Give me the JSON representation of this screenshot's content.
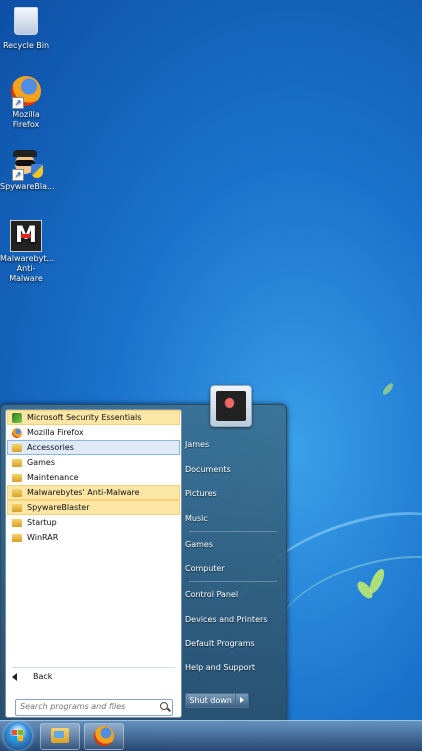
{
  "desktop": {
    "icons": [
      {
        "label": "Recycle Bin",
        "icon": "recycle-bin-icon"
      },
      {
        "label": "Mozilla Firefox",
        "icon": "firefox-icon"
      },
      {
        "label": "SpywareBla...",
        "icon": "spywareblaster-icon"
      },
      {
        "label": "Malwarebyt... Anti-Malware",
        "icon": "malwarebytes-icon"
      }
    ]
  },
  "start_menu": {
    "programs": [
      {
        "label": "Microsoft Security Essentials",
        "icon": "security-essentials-icon",
        "state": "highlighted"
      },
      {
        "label": "Mozilla Firefox",
        "icon": "firefox-icon",
        "state": "normal"
      },
      {
        "label": "Accessories",
        "icon": "folder-icon",
        "state": "selected"
      },
      {
        "label": "Games",
        "icon": "folder-icon",
        "state": "normal"
      },
      {
        "label": "Maintenance",
        "icon": "folder-icon",
        "state": "normal"
      },
      {
        "label": "Malwarebytes' Anti-Malware",
        "icon": "folder-icon",
        "state": "highlighted"
      },
      {
        "label": "SpywareBlaster",
        "icon": "folder-icon",
        "state": "highlighted"
      },
      {
        "label": "Startup",
        "icon": "folder-icon",
        "state": "normal"
      },
      {
        "label": "WinRAR",
        "icon": "folder-icon",
        "state": "normal"
      }
    ],
    "back_label": "Back",
    "search_placeholder": "Search programs and files",
    "right_items": [
      "James",
      "Documents",
      "Pictures",
      "Music",
      "Games",
      "Computer",
      "Control Panel",
      "Devices and Printers",
      "Default Programs",
      "Help and Support"
    ],
    "shutdown_label": "Shut down"
  },
  "taskbar": {
    "buttons": [
      {
        "name": "windows-explorer",
        "icon": "windows-explorer-icon"
      },
      {
        "name": "firefox",
        "icon": "firefox-icon"
      }
    ]
  },
  "colors": {
    "highlight": "#fbe6a5",
    "selected": "#dfeaf7",
    "desktop": "#1a73cc"
  }
}
